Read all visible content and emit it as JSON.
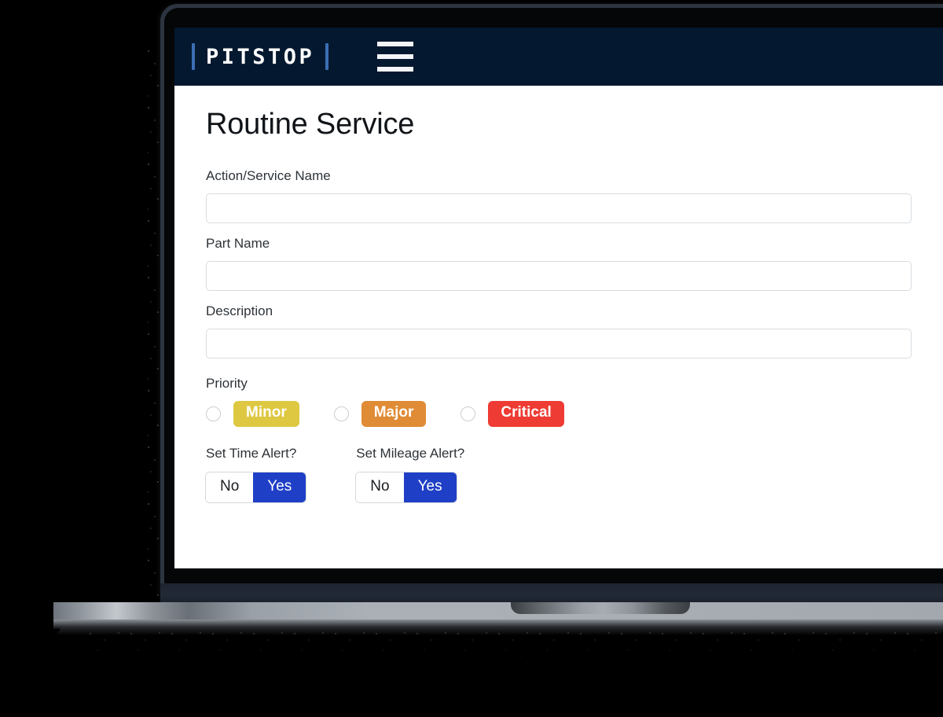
{
  "brand": {
    "name": "PITSTOP",
    "left_bar": "|",
    "right_bar": "|",
    "bar_color": "#3c6fb5",
    "navbar_color": "#04182f"
  },
  "nav": {
    "menu_icon": "hamburger-menu-icon"
  },
  "page": {
    "title": "Routine Service"
  },
  "fields": [
    {
      "label": "Action/Service Name",
      "value": "",
      "placeholder": ""
    },
    {
      "label": "Part Name",
      "value": "",
      "placeholder": ""
    },
    {
      "label": "Description",
      "value": "",
      "placeholder": ""
    }
  ],
  "priority": {
    "label": "Priority",
    "selected": "",
    "options": [
      {
        "label": "Minor",
        "color": "#dec841",
        "selected": false
      },
      {
        "label": "Major",
        "color": "#e08b35",
        "selected": false
      },
      {
        "label": "Critical",
        "color": "#ee3b33",
        "selected": false
      }
    ]
  },
  "alerts": [
    {
      "label": "Set Time Alert?",
      "off_label": "No",
      "on_label": "Yes",
      "selected": "Yes"
    },
    {
      "label": "Set Mileage Alert?",
      "off_label": "No",
      "on_label": "Yes",
      "selected": "Yes"
    }
  ],
  "theme": {
    "accent_blue": "#1f3fc6",
    "navbar_navy": "#04182f",
    "input_border": "#d8dce0",
    "label_text": "#2e3338"
  }
}
